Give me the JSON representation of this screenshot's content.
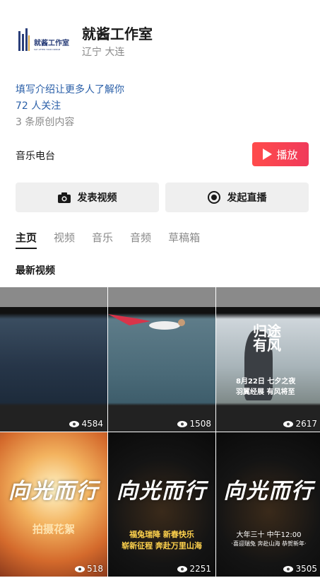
{
  "profile": {
    "logo_text": "就酱工作室",
    "logo_subtext": "SAY AFTER YOUR DREAM",
    "name": "就酱工作室",
    "location": "辽宁 大连",
    "intro": "填写介绍让更多人了解你",
    "follow_count": "72 人关注",
    "original_count": "3 条原创内容"
  },
  "radio": {
    "label": "音乐电台",
    "play_label": "播放"
  },
  "actions": {
    "post_video": "发表视频",
    "start_live": "发起直播"
  },
  "tabs": [
    {
      "label": "主页",
      "active": true
    },
    {
      "label": "视频",
      "active": false
    },
    {
      "label": "音乐",
      "active": false
    },
    {
      "label": "音频",
      "active": false
    },
    {
      "label": "草稿箱",
      "active": false
    }
  ],
  "section_title": "最新视频",
  "videos": [
    {
      "views": "4584"
    },
    {
      "views": "1508"
    },
    {
      "views": "2617",
      "poster_title": "归途有风",
      "poster_line1": "8月22日 七夕之夜",
      "poster_line2": "羽翼经展 有风将至"
    },
    {
      "views": "518",
      "title": "向光而行",
      "subtitle": "拍摄花絮"
    },
    {
      "views": "2251",
      "title": "向光而行",
      "subtitle1": "福兔瑞降 新春快乐",
      "subtitle2": "崭新征程 奔赴万里山海"
    },
    {
      "views": "3505",
      "title": "向光而行",
      "subtitle1": "大年三十 中午12:00",
      "subtitle2": "·喜迎瑞兔 奔赴山海 恭贺新年·"
    }
  ],
  "colors": {
    "link": "#2a5fa8",
    "play_button": "#f03a5a",
    "muted": "#8a8a8a"
  }
}
